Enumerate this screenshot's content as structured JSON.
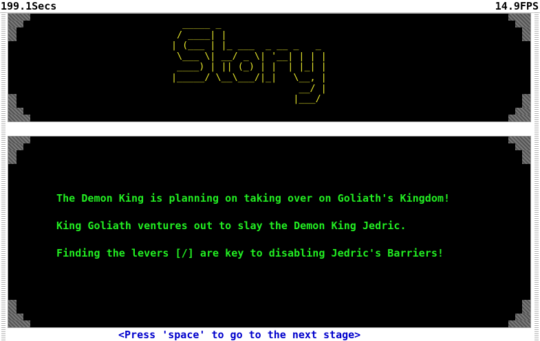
{
  "hud": {
    "timer": "199.1Secs",
    "fps": "14.9FPS"
  },
  "title_ascii": "  _____ _\n / ____| |\n| (___ | |_ ___  _ __ _   _\n \\___ \\| __/ _ \\| '__| | | |\n ____) | || (_) | |  | |_| |\n|_____/ \\__\\___/|_|   \\__, |\n                       __/ |\n                      |___/",
  "story": {
    "lines": [
      "The Demon King is planning on taking over on Goliath's Kingdom!",
      "King Goliath ventures out to slay the Demon King Jedric.",
      "Finding the levers [/] are key to disabling Jedric's Barriers!"
    ]
  },
  "prompt": "<Press 'space' to go to the next stage>",
  "colors": {
    "panel_bg": "#000000",
    "title_text": "#e6e62a",
    "story_text": "#22ee22",
    "prompt_text": "#0000cc"
  }
}
